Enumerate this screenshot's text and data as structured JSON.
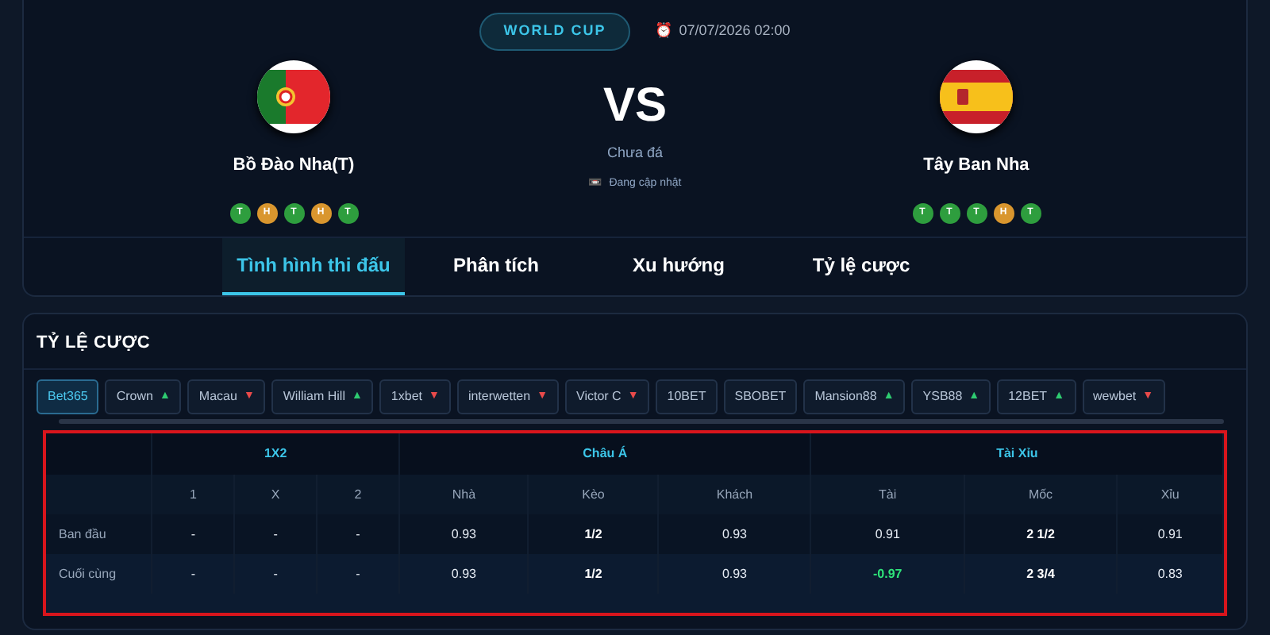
{
  "match": {
    "competition": "WORLD CUP",
    "time_icon": "⏰",
    "datetime": "07/07/2026 02:00",
    "vs": "VS",
    "status": "Chưa đá",
    "update_icon": "📼",
    "update": "Đang cập nhật",
    "home": {
      "name": "Bồ Đào Nha(T)",
      "form": [
        {
          "label": "T",
          "color": "#2e9e3e"
        },
        {
          "label": "H",
          "color": "#d9962e"
        },
        {
          "label": "T",
          "color": "#2e9e3e"
        },
        {
          "label": "H",
          "color": "#d9962e"
        },
        {
          "label": "T",
          "color": "#2e9e3e"
        }
      ]
    },
    "away": {
      "name": "Tây Ban Nha",
      "form": [
        {
          "label": "T",
          "color": "#2e9e3e"
        },
        {
          "label": "T",
          "color": "#2e9e3e"
        },
        {
          "label": "T",
          "color": "#2e9e3e"
        },
        {
          "label": "H",
          "color": "#d9962e"
        },
        {
          "label": "T",
          "color": "#2e9e3e"
        }
      ]
    }
  },
  "tabs": [
    {
      "label": "Tình hình thi đấu",
      "selected": true
    },
    {
      "label": "Phân tích",
      "selected": false
    },
    {
      "label": "Xu hướng",
      "selected": false
    },
    {
      "label": "Tỷ lệ cược",
      "selected": false
    }
  ],
  "odds": {
    "title": "TỶ LỆ CƯỢC",
    "bookmakers": [
      {
        "name": "Bet365",
        "selected": true
      },
      {
        "name": "Crown",
        "selected": false,
        "arrow": "▲",
        "rising": true
      },
      {
        "name": "Macau",
        "selected": false,
        "arrow": "▼",
        "rising": false
      },
      {
        "name": "William Hill",
        "selected": false,
        "arrow": "▲",
        "rising": true
      },
      {
        "name": "1xbet",
        "selected": false,
        "arrow": "▼",
        "rising": false
      },
      {
        "name": "interwetten",
        "selected": false,
        "arrow": "▼",
        "rising": false
      },
      {
        "name": "Victor C",
        "selected": false,
        "arrow": "▼",
        "rising": false
      },
      {
        "name": "10BET",
        "selected": false
      },
      {
        "name": "SBOBET",
        "selected": false
      },
      {
        "name": "Mansion88",
        "selected": false,
        "arrow": "▲",
        "rising": true
      },
      {
        "name": "YSB88",
        "selected": false,
        "arrow": "▲",
        "rising": true
      },
      {
        "name": "12BET",
        "selected": false,
        "arrow": "▲",
        "rising": true
      },
      {
        "name": "wewbet",
        "selected": false,
        "arrow": "▼",
        "rising": false
      }
    ],
    "table": {
      "groups": [
        {
          "label": "1X2",
          "columns": [
            {
              "label": "1",
              "bold": false
            },
            {
              "label": "X",
              "bold": false
            },
            {
              "label": "2",
              "bold": false
            }
          ]
        },
        {
          "label": "Châu Á",
          "columns": [
            {
              "label": "Nhà",
              "bold": false
            },
            {
              "label": "Kèo",
              "bold": true
            },
            {
              "label": "Khách",
              "bold": false
            }
          ]
        },
        {
          "label": "Tài Xỉu",
          "columns": [
            {
              "label": "Tài",
              "bold": false
            },
            {
              "label": "Mốc",
              "bold": true
            },
            {
              "label": "Xỉu",
              "bold": false
            }
          ]
        }
      ],
      "rows": [
        {
          "label": "Ban đầu",
          "cells": [
            {
              "text": "-",
              "changed": false
            },
            {
              "text": "-",
              "changed": false
            },
            {
              "text": "-",
              "changed": false
            },
            {
              "text": "0.93",
              "changed": false
            },
            {
              "text": "1/2",
              "changed": false
            },
            {
              "text": "0.93",
              "changed": false
            },
            {
              "text": "0.91",
              "changed": false
            },
            {
              "text": "2 1/2",
              "changed": false
            },
            {
              "text": "0.91",
              "changed": false
            }
          ]
        },
        {
          "label": "Cuối cùng",
          "cells": [
            {
              "text": "-",
              "changed": false
            },
            {
              "text": "-",
              "changed": false
            },
            {
              "text": "-",
              "changed": false
            },
            {
              "text": "0.93",
              "changed": false
            },
            {
              "text": "1/2",
              "changed": false
            },
            {
              "text": "0.93",
              "changed": false
            },
            {
              "text": "-0.97",
              "changed": true
            },
            {
              "text": "2 3/4",
              "changed": false
            },
            {
              "text": "0.83",
              "changed": false
            }
          ]
        }
      ],
      "highlighted": true
    }
  }
}
